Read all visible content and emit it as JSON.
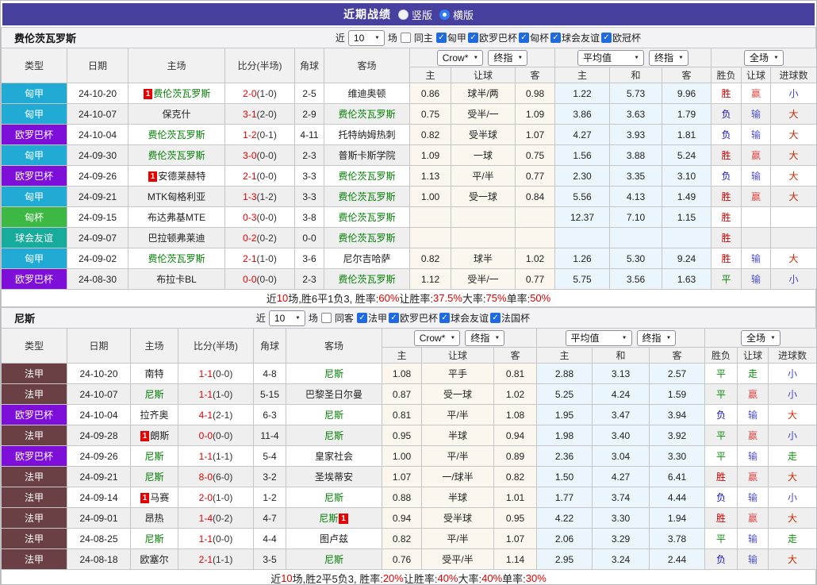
{
  "titlebar": {
    "title": "近期战绩",
    "vertical_label": "竖版",
    "horizontal_label": "横版",
    "selected_option": "横版"
  },
  "controls": {
    "odds_source": "Crow*",
    "final1": "终指",
    "average": "平均值",
    "final2": "终指",
    "scope": "全场"
  },
  "columns": {
    "type": "类型",
    "date": "日期",
    "home": "主场",
    "score": "比分(半场)",
    "corners": "角球",
    "away": "客场",
    "h": "主",
    "handicap": "让球",
    "a": "客",
    "avg_h": "主",
    "avg_d": "和",
    "avg_a": "客",
    "wl": "胜负",
    "handicap_result": "让球",
    "goals": "进球数"
  },
  "filter_common": {
    "near": "近",
    "count": "10",
    "unit": "场"
  },
  "colors": {
    "titlebar_bg": "#47409f",
    "score_red": "#e60000",
    "team_green": "#008000",
    "badge_red": "#e60000",
    "summary_red": "#e60000",
    "league": {
      "匈甲": "#21aad4",
      "欧罗巴杯": "#7d0fd8",
      "匈杯": "#3eb845",
      "球会友谊": "#17ab9b",
      "法甲": "#6b4045"
    },
    "result": {
      "胜": "#d10000",
      "负": "#1010c0",
      "平": "#0a8f0a",
      "赢": "#e14b4b",
      "输": "#5050d2",
      "走": "#0a8f0a",
      "大": "#cc2a00",
      "小": "#4040cc"
    }
  },
  "tables": [
    {
      "team": "费伦茨瓦罗斯",
      "same_label": "同主",
      "same_checked": false,
      "leagues": [
        "匈甲",
        "欧罗巴杯",
        "匈杯",
        "球会友谊",
        "欧冠杯"
      ],
      "rows": [
        {
          "lg": "匈甲",
          "date": "24-10-20",
          "home": "费伦茨瓦罗斯",
          "hb": true,
          "hg": true,
          "score": "2-0",
          "half": "(1-0)",
          "corner": "2-5",
          "away": "维迪奥顿",
          "ag": false,
          "o": [
            "0.86",
            "球半/两",
            "0.98"
          ],
          "avg": [
            "1.22",
            "5.73",
            "9.96"
          ],
          "r": [
            "胜",
            "赢",
            "小"
          ]
        },
        {
          "lg": "匈甲",
          "date": "24-10-07",
          "home": "保克什",
          "hg": false,
          "score": "3-1",
          "half": "(2-0)",
          "corner": "2-9",
          "away": "费伦茨瓦罗斯",
          "ag": true,
          "o": [
            "0.75",
            "受半/一",
            "1.09"
          ],
          "avg": [
            "3.86",
            "3.63",
            "1.79"
          ],
          "r": [
            "负",
            "输",
            "大"
          ]
        },
        {
          "lg": "欧罗巴杯",
          "date": "24-10-04",
          "home": "费伦茨瓦罗斯",
          "hg": true,
          "score": "1-2",
          "half": "(0-1)",
          "corner": "4-11",
          "away": "托特纳姆热刺",
          "ag": false,
          "o": [
            "0.82",
            "受半球",
            "1.07"
          ],
          "avg": [
            "4.27",
            "3.93",
            "1.81"
          ],
          "r": [
            "负",
            "输",
            "大"
          ]
        },
        {
          "lg": "匈甲",
          "date": "24-09-30",
          "home": "费伦茨瓦罗斯",
          "hg": true,
          "score": "3-0",
          "half": "(0-0)",
          "corner": "2-3",
          "away": "普斯卡斯学院",
          "ag": false,
          "o": [
            "1.09",
            "一球",
            "0.75"
          ],
          "avg": [
            "1.56",
            "3.88",
            "5.24"
          ],
          "r": [
            "胜",
            "赢",
            "大"
          ]
        },
        {
          "lg": "欧罗巴杯",
          "date": "24-09-26",
          "home": "安德莱赫特",
          "hb": true,
          "hg": false,
          "score": "2-1",
          "half": "(0-0)",
          "corner": "3-3",
          "away": "费伦茨瓦罗斯",
          "ag": true,
          "o": [
            "1.13",
            "平/半",
            "0.77"
          ],
          "avg": [
            "2.30",
            "3.35",
            "3.10"
          ],
          "r": [
            "负",
            "输",
            "大"
          ]
        },
        {
          "lg": "匈甲",
          "date": "24-09-21",
          "home": "MTK匈格利亚",
          "hg": false,
          "score": "1-3",
          "half": "(1-2)",
          "corner": "3-3",
          "away": "费伦茨瓦罗斯",
          "ag": true,
          "o": [
            "1.00",
            "受一球",
            "0.84"
          ],
          "avg": [
            "5.56",
            "4.13",
            "1.49"
          ],
          "r": [
            "胜",
            "赢",
            "大"
          ]
        },
        {
          "lg": "匈杯",
          "date": "24-09-15",
          "home": "布达弗基MTE",
          "hg": false,
          "score": "0-3",
          "half": "(0-0)",
          "corner": "3-8",
          "away": "费伦茨瓦罗斯",
          "ag": true,
          "o": [
            "",
            "",
            ""
          ],
          "avg": [
            "12.37",
            "7.10",
            "1.15"
          ],
          "r": [
            "胜",
            "",
            ""
          ]
        },
        {
          "lg": "球会友谊",
          "date": "24-09-07",
          "home": "巴拉顿弗莱迪",
          "hg": false,
          "score": "0-2",
          "half": "(0-2)",
          "corner": "0-0",
          "away": "费伦茨瓦罗斯",
          "ag": true,
          "o": [
            "",
            "",
            ""
          ],
          "avg": [
            "",
            "",
            ""
          ],
          "r": [
            "胜",
            "",
            ""
          ]
        },
        {
          "lg": "匈甲",
          "date": "24-09-02",
          "home": "费伦茨瓦罗斯",
          "hg": true,
          "score": "2-1",
          "half": "(1-0)",
          "corner": "3-6",
          "away": "尼尔吉哈萨",
          "ag": false,
          "o": [
            "0.82",
            "球半",
            "1.02"
          ],
          "avg": [
            "1.26",
            "5.30",
            "9.24"
          ],
          "r": [
            "胜",
            "输",
            "大"
          ]
        },
        {
          "lg": "欧罗巴杯",
          "date": "24-08-30",
          "home": "布拉卡BL",
          "hg": false,
          "score": "0-0",
          "half": "(0-0)",
          "corner": "2-3",
          "away": "费伦茨瓦罗斯",
          "ag": true,
          "o": [
            "1.12",
            "受半/一",
            "0.77"
          ],
          "avg": [
            "5.75",
            "3.56",
            "1.63"
          ],
          "r": [
            "平",
            "输",
            "小"
          ]
        }
      ],
      "summary": [
        {
          "t": "近",
          "c": "k"
        },
        {
          "t": "10",
          "c": "r"
        },
        {
          "t": "场,胜6平1负3, 胜率:",
          "c": "k"
        },
        {
          "t": "60%",
          "c": "r"
        },
        {
          "t": " 让胜率:",
          "c": "k"
        },
        {
          "t": "37.5%",
          "c": "r"
        },
        {
          "t": " 大率:",
          "c": "k"
        },
        {
          "t": "75%",
          "c": "r"
        },
        {
          "t": " 单率:",
          "c": "k"
        },
        {
          "t": "50%",
          "c": "r"
        }
      ]
    },
    {
      "team": "尼斯",
      "same_label": "同客",
      "same_checked": false,
      "leagues": [
        "法甲",
        "欧罗巴杯",
        "球会友谊",
        "法国杯"
      ],
      "rows": [
        {
          "lg": "法甲",
          "date": "24-10-20",
          "home": "南特",
          "hg": false,
          "score": "1-1",
          "half": "(0-0)",
          "corner": "4-8",
          "away": "尼斯",
          "ag": true,
          "o": [
            "1.08",
            "平手",
            "0.81"
          ],
          "avg": [
            "2.88",
            "3.13",
            "2.57"
          ],
          "r": [
            "平",
            "走",
            "小"
          ]
        },
        {
          "lg": "法甲",
          "date": "24-10-07",
          "home": "尼斯",
          "hg": true,
          "score": "1-1",
          "half": "(1-0)",
          "corner": "5-15",
          "away": "巴黎圣日尔曼",
          "ag": false,
          "o": [
            "0.87",
            "受一球",
            "1.02"
          ],
          "avg": [
            "5.25",
            "4.24",
            "1.59"
          ],
          "r": [
            "平",
            "赢",
            "小"
          ]
        },
        {
          "lg": "欧罗巴杯",
          "date": "24-10-04",
          "home": "拉齐奥",
          "hg": false,
          "score": "4-1",
          "half": "(2-1)",
          "corner": "6-3",
          "away": "尼斯",
          "ag": true,
          "o": [
            "0.81",
            "平/半",
            "1.08"
          ],
          "avg": [
            "1.95",
            "3.47",
            "3.94"
          ],
          "r": [
            "负",
            "输",
            "大"
          ]
        },
        {
          "lg": "法甲",
          "date": "24-09-28",
          "home": "朗斯",
          "hb": true,
          "hg": false,
          "score": "0-0",
          "half": "(0-0)",
          "corner": "11-4",
          "away": "尼斯",
          "ag": true,
          "o": [
            "0.95",
            "半球",
            "0.94"
          ],
          "avg": [
            "1.98",
            "3.40",
            "3.92"
          ],
          "r": [
            "平",
            "赢",
            "小"
          ]
        },
        {
          "lg": "欧罗巴杯",
          "date": "24-09-26",
          "home": "尼斯",
          "hg": true,
          "score": "1-1",
          "half": "(1-1)",
          "corner": "5-4",
          "away": "皇家社会",
          "ag": false,
          "o": [
            "1.00",
            "平/半",
            "0.89"
          ],
          "avg": [
            "2.36",
            "3.04",
            "3.30"
          ],
          "r": [
            "平",
            "输",
            "走"
          ]
        },
        {
          "lg": "法甲",
          "date": "24-09-21",
          "home": "尼斯",
          "hg": true,
          "score": "8-0",
          "half": "(6-0)",
          "corner": "3-2",
          "away": "圣埃蒂安",
          "ag": false,
          "o": [
            "1.07",
            "一/球半",
            "0.82"
          ],
          "avg": [
            "1.50",
            "4.27",
            "6.41"
          ],
          "r": [
            "胜",
            "赢",
            "大"
          ]
        },
        {
          "lg": "法甲",
          "date": "24-09-14",
          "home": "马赛",
          "hb": true,
          "hg": false,
          "score": "2-0",
          "half": "(1-0)",
          "corner": "1-2",
          "away": "尼斯",
          "ag": true,
          "o": [
            "0.88",
            "半球",
            "1.01"
          ],
          "avg": [
            "1.77",
            "3.74",
            "4.44"
          ],
          "r": [
            "负",
            "输",
            "小"
          ]
        },
        {
          "lg": "法甲",
          "date": "24-09-01",
          "home": "昂热",
          "hg": false,
          "score": "1-4",
          "half": "(0-2)",
          "corner": "4-7",
          "away": "尼斯",
          "ag": true,
          "ab": true,
          "o": [
            "0.94",
            "受半球",
            "0.95"
          ],
          "avg": [
            "4.22",
            "3.30",
            "1.94"
          ],
          "r": [
            "胜",
            "赢",
            "大"
          ]
        },
        {
          "lg": "法甲",
          "date": "24-08-25",
          "home": "尼斯",
          "hg": true,
          "score": "1-1",
          "half": "(0-0)",
          "corner": "4-4",
          "away": "图卢兹",
          "ag": false,
          "o": [
            "0.82",
            "平/半",
            "1.07"
          ],
          "avg": [
            "2.06",
            "3.29",
            "3.78"
          ],
          "r": [
            "平",
            "输",
            "走"
          ]
        },
        {
          "lg": "法甲",
          "date": "24-08-18",
          "home": "欧塞尔",
          "hg": false,
          "score": "2-1",
          "half": "(1-1)",
          "corner": "3-5",
          "away": "尼斯",
          "ag": true,
          "o": [
            "0.76",
            "受平/半",
            "1.14"
          ],
          "avg": [
            "2.95",
            "3.24",
            "2.44"
          ],
          "r": [
            "负",
            "输",
            "大"
          ]
        }
      ],
      "summary": [
        {
          "t": "近",
          "c": "k"
        },
        {
          "t": "10",
          "c": "r"
        },
        {
          "t": "场,胜2平5负3, 胜率:",
          "c": "k"
        },
        {
          "t": "20%",
          "c": "r"
        },
        {
          "t": " 让胜率:",
          "c": "k"
        },
        {
          "t": "40%",
          "c": "r"
        },
        {
          "t": " 大率:",
          "c": "k"
        },
        {
          "t": "40%",
          "c": "r"
        },
        {
          "t": " 单率:",
          "c": "k"
        },
        {
          "t": "30%",
          "c": "r"
        }
      ]
    }
  ]
}
